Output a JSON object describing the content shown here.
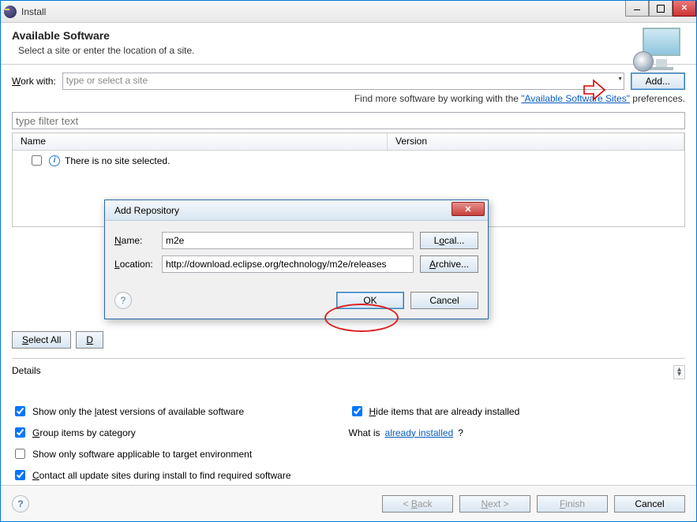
{
  "window": {
    "title": "Install"
  },
  "banner": {
    "heading": "Available Software",
    "subtitle": "Select a site or enter the location of a site."
  },
  "work_with": {
    "label_pre": "Work with:",
    "placeholder": "type or select a site",
    "add_button": "Add..."
  },
  "hint": {
    "prefix": "Find more software by working with the ",
    "link": "\"Available Software Sites\"",
    "suffix": " preferences."
  },
  "filter": {
    "placeholder": "type filter text"
  },
  "table": {
    "columns": {
      "name": "Name",
      "version": "Version"
    },
    "empty_message": "There is no site selected."
  },
  "selection_buttons": {
    "select_all": "Select All",
    "deselect_all_first_char": "D"
  },
  "details": {
    "label": "Details"
  },
  "options": {
    "show_latest": "Show only the latest versions of available software",
    "hide_installed": "Hide items that are already installed",
    "group_by_category": "Group items by category",
    "what_is_prefix": "What is ",
    "what_is_link": "already installed",
    "what_is_suffix": "?",
    "applicable_target": "Show only software applicable to target environment",
    "contact_all_sites": "Contact all update sites during install to find required software",
    "checked": {
      "show_latest": true,
      "hide_installed": true,
      "group_by_category": true,
      "applicable_target": false,
      "contact_all_sites": true
    }
  },
  "footer": {
    "back": "< Back",
    "next": "Next >",
    "finish": "Finish",
    "cancel": "Cancel"
  },
  "modal": {
    "title": "Add Repository",
    "name_label": "Name:",
    "name_value": "m2e",
    "location_label": "Location:",
    "location_value": "http://download.eclipse.org/technology/m2e/releases",
    "local_button": "Local...",
    "archive_button": "Archive...",
    "ok": "OK",
    "cancel": "Cancel"
  }
}
